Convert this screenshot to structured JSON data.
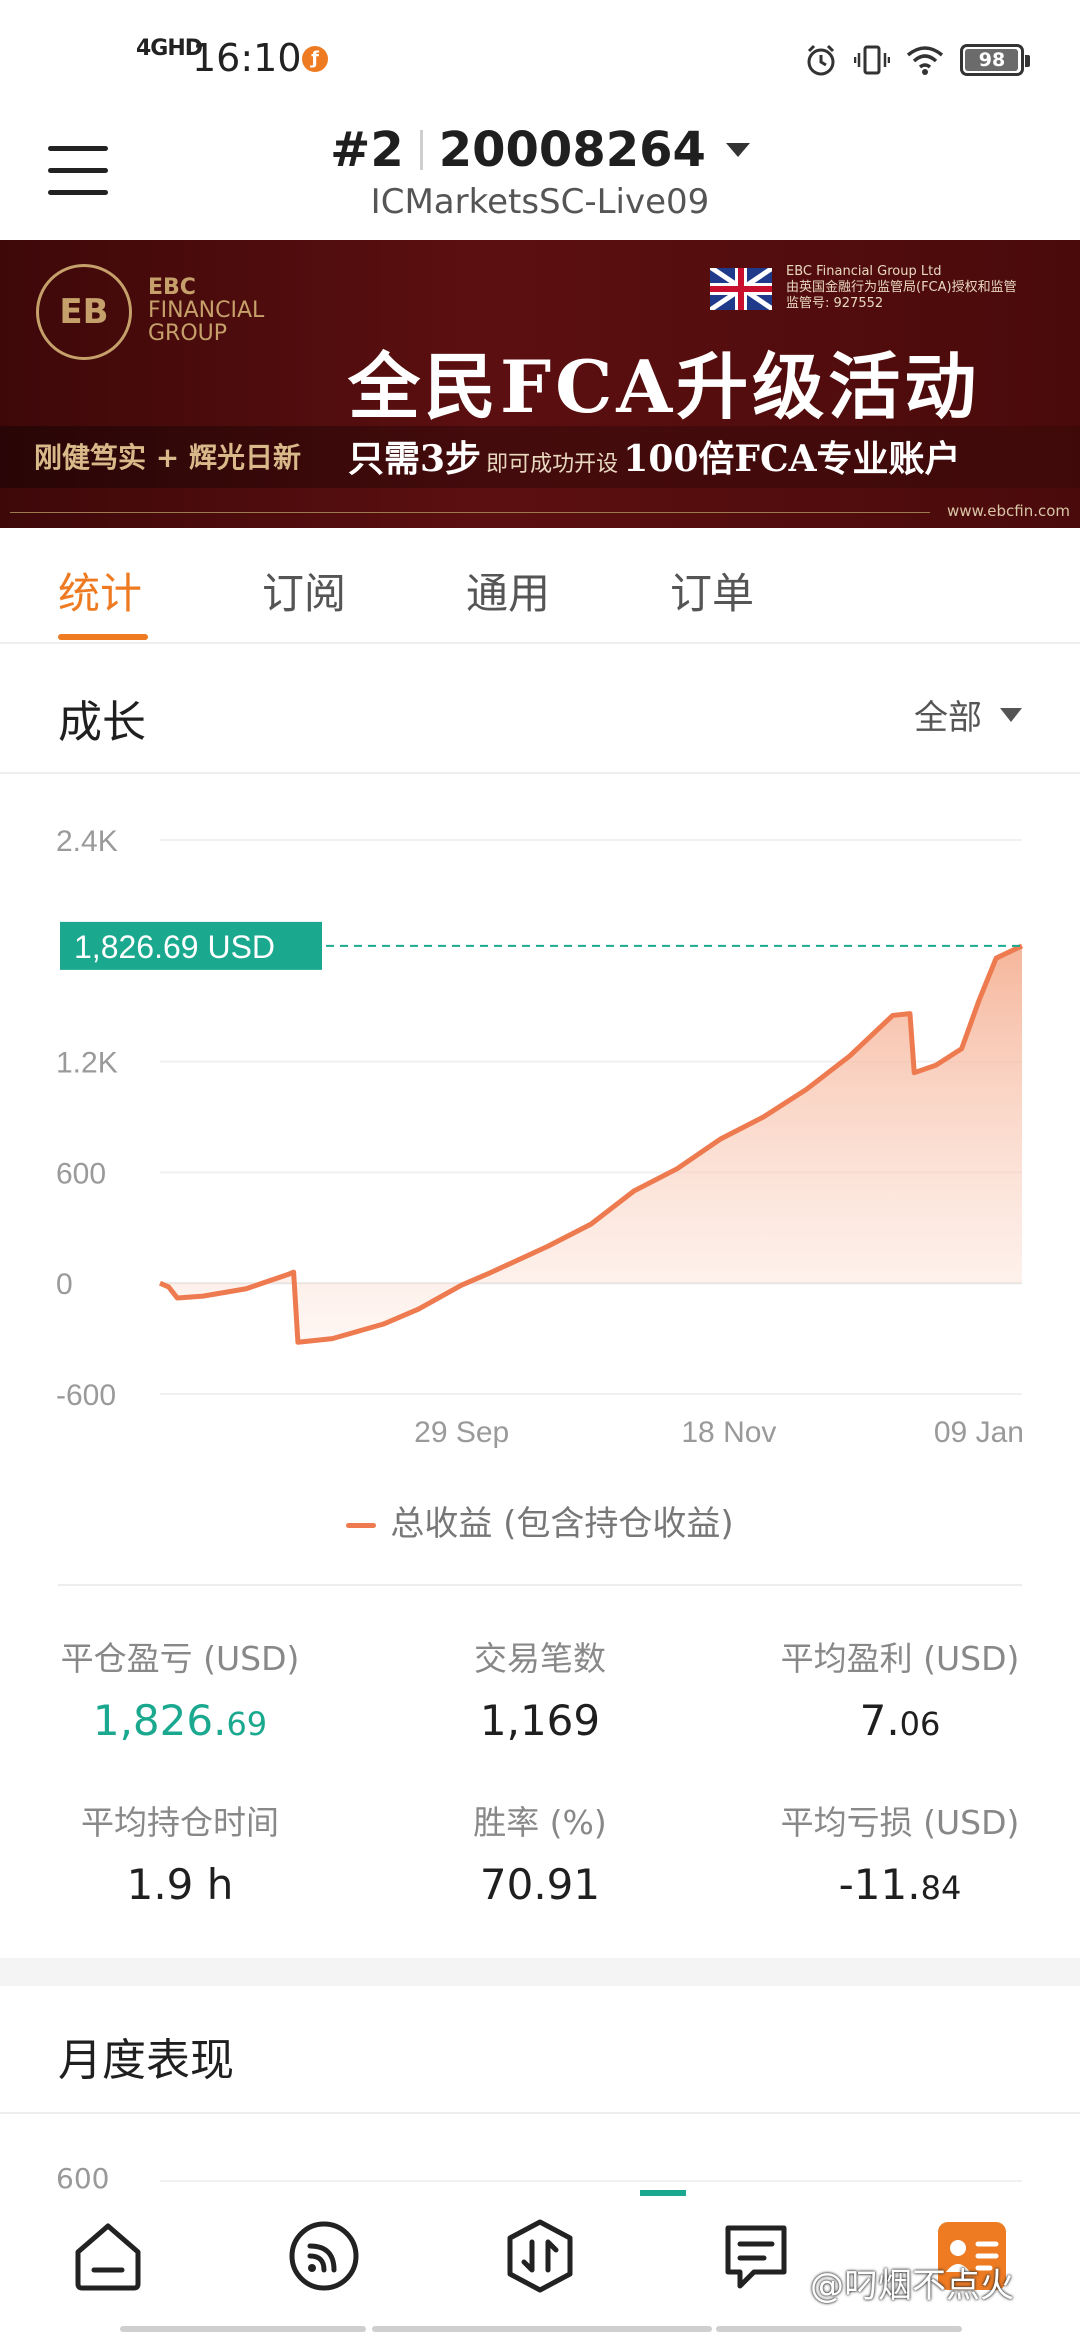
{
  "status_bar": {
    "network": "4GHD",
    "time": "16:10",
    "battery": "98",
    "battery_level": 0.98
  },
  "header": {
    "account_number": "#2",
    "account_id": "20008264",
    "server": "ICMarketsSC-Live09"
  },
  "banner": {
    "brand_line1": "EBC",
    "brand_line2": "FINANCIAL",
    "brand_line3": "GROUP",
    "fca_line1": "EBC Financial Group Ltd",
    "fca_line2": "由英国金融行为监管局(FCA)授权和监管",
    "fca_line3": "监管号: 927552",
    "headline": "全民FCA升级活动",
    "slogan": "刚健笃实 + 辉光日新",
    "offer_big1": "只需3步",
    "offer_small": "即可成功开设",
    "offer_big2": "100倍FCA专业账户",
    "url": "www.ebcfin.com"
  },
  "tabs": [
    {
      "label": "统计",
      "active": true
    },
    {
      "label": "订阅",
      "active": false
    },
    {
      "label": "通用",
      "active": false
    },
    {
      "label": "订单",
      "active": false
    }
  ],
  "growth": {
    "title": "成长",
    "filter": "全部",
    "current_value_label": "1,826.69 USD",
    "legend": "总收益 (包含持仓收益)"
  },
  "chart_data": {
    "type": "area",
    "title": "",
    "xlabel": "",
    "ylabel": "",
    "ylim": [
      -600,
      2400
    ],
    "y_ticks": [
      "2.4K",
      "1.2K",
      "600",
      "0",
      "-600"
    ],
    "x_tick_labels": [
      "29 Sep",
      "18 Nov",
      "09 Jan"
    ],
    "series": [
      {
        "name": "总收益 (包含持仓收益)",
        "x": [
          0,
          0.01,
          0.02,
          0.05,
          0.1,
          0.15,
          0.155,
          0.16,
          0.2,
          0.26,
          0.3,
          0.35,
          0.38,
          0.45,
          0.5,
          0.55,
          0.6,
          0.65,
          0.7,
          0.75,
          0.8,
          0.85,
          0.87,
          0.875,
          0.9,
          0.93,
          0.95,
          0.97,
          1.0
        ],
        "values": [
          0,
          -20,
          -80,
          -70,
          -30,
          50,
          60,
          -320,
          -300,
          -220,
          -140,
          -10,
          50,
          200,
          320,
          500,
          620,
          780,
          900,
          1050,
          1230,
          1450,
          1460,
          1140,
          1180,
          1270,
          1530,
          1760,
          1826.69
        ]
      }
    ],
    "reference_value": 1826.69,
    "colors": {
      "line": "#ee7b50",
      "fill": "#f7c3ae",
      "reference": "#1aa98f"
    },
    "grid": true,
    "legend_position": "bottom"
  },
  "stats": [
    {
      "label": "平仓盈亏 (USD)",
      "int": "1,826.",
      "dec": "69",
      "positive": true
    },
    {
      "label": "交易笔数",
      "int": "1,169",
      "dec": "",
      "positive": false
    },
    {
      "label": "平均盈利 (USD)",
      "int": "7.",
      "dec": "06",
      "positive": false
    },
    {
      "label": "平均持仓时间",
      "int": "1.9 h",
      "dec": "",
      "positive": false
    },
    {
      "label": "胜率 (%)",
      "int": "70.91",
      "dec": "",
      "positive": false
    },
    {
      "label": "平均亏损 (USD)",
      "int": "-11.",
      "dec": "84",
      "positive": false
    }
  ],
  "monthly": {
    "title": "月度表现",
    "first_tick": "600"
  },
  "bottom_nav": {
    "icons": [
      "home-icon",
      "feed-icon",
      "trade-icon",
      "orders-icon",
      "profile-icon"
    ],
    "watermark": "@叼烟不点火"
  },
  "colors": {
    "accent": "#ee7b22",
    "positive": "#1aa98f",
    "banner_bg": "#4a0a0b"
  }
}
